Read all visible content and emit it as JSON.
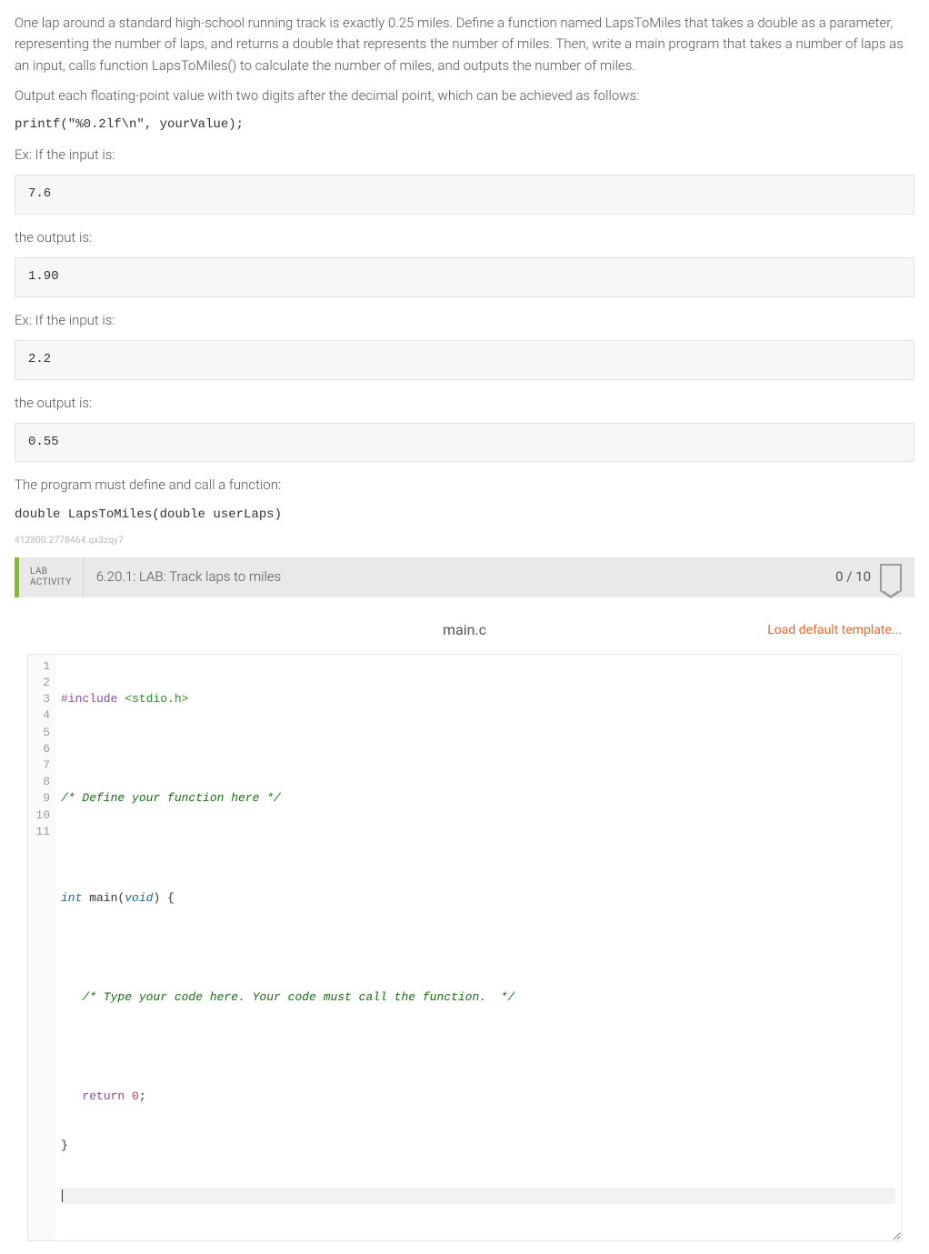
{
  "instructions": {
    "p1": "One lap around a standard high-school running track is exactly 0.25 miles. Define a function named LapsToMiles that takes a double as a parameter, representing the number of laps, and returns a double that represents the number of miles. Then, write a main program that takes a number of laps as an input, calls function LapsToMiles() to calculate the number of miles, and outputs the number of miles.",
    "p2": "Output each floating-point value with two digits after the decimal point, which can be achieved as follows:",
    "printf_line": "printf(\"%0.2lf\\n\", yourValue);",
    "ex_label_1": "Ex: If the input is:",
    "input1": "7.6",
    "output_label": "the output is:",
    "output1": "1.90",
    "ex_label_2": "Ex: If the input is:",
    "input2": "2.2",
    "output2": "0.55",
    "must_define": "The program must define and call a function:",
    "signature": "double LapsToMiles(double userLaps)",
    "small_id": "412800.2778464.qx3zqy7"
  },
  "lab": {
    "tag_line1": "LAB",
    "tag_line2": "ACTIVITY",
    "title": "6.20.1: LAB: Track laps to miles",
    "score": "0 / 10"
  },
  "editor": {
    "filename": "main.c",
    "load_template": "Load default template...",
    "gutter": [
      "1",
      "2",
      "3",
      "4",
      "5",
      "6",
      "7",
      "8",
      "9",
      "10",
      "11"
    ],
    "code": {
      "include_pp": "#include",
      "include_lib": " <stdio.h>",
      "comment_define": "/* Define your function here */",
      "int": "int",
      "main": " main",
      "void": "void",
      "main_rest_open": "(",
      "main_rest_close": ") {",
      "comment_type": "   /* Type your code here. Your code must call the function.  */",
      "return_kw": "   return",
      "zero": " 0",
      "semicolon": ";",
      "close_brace": "}"
    }
  }
}
